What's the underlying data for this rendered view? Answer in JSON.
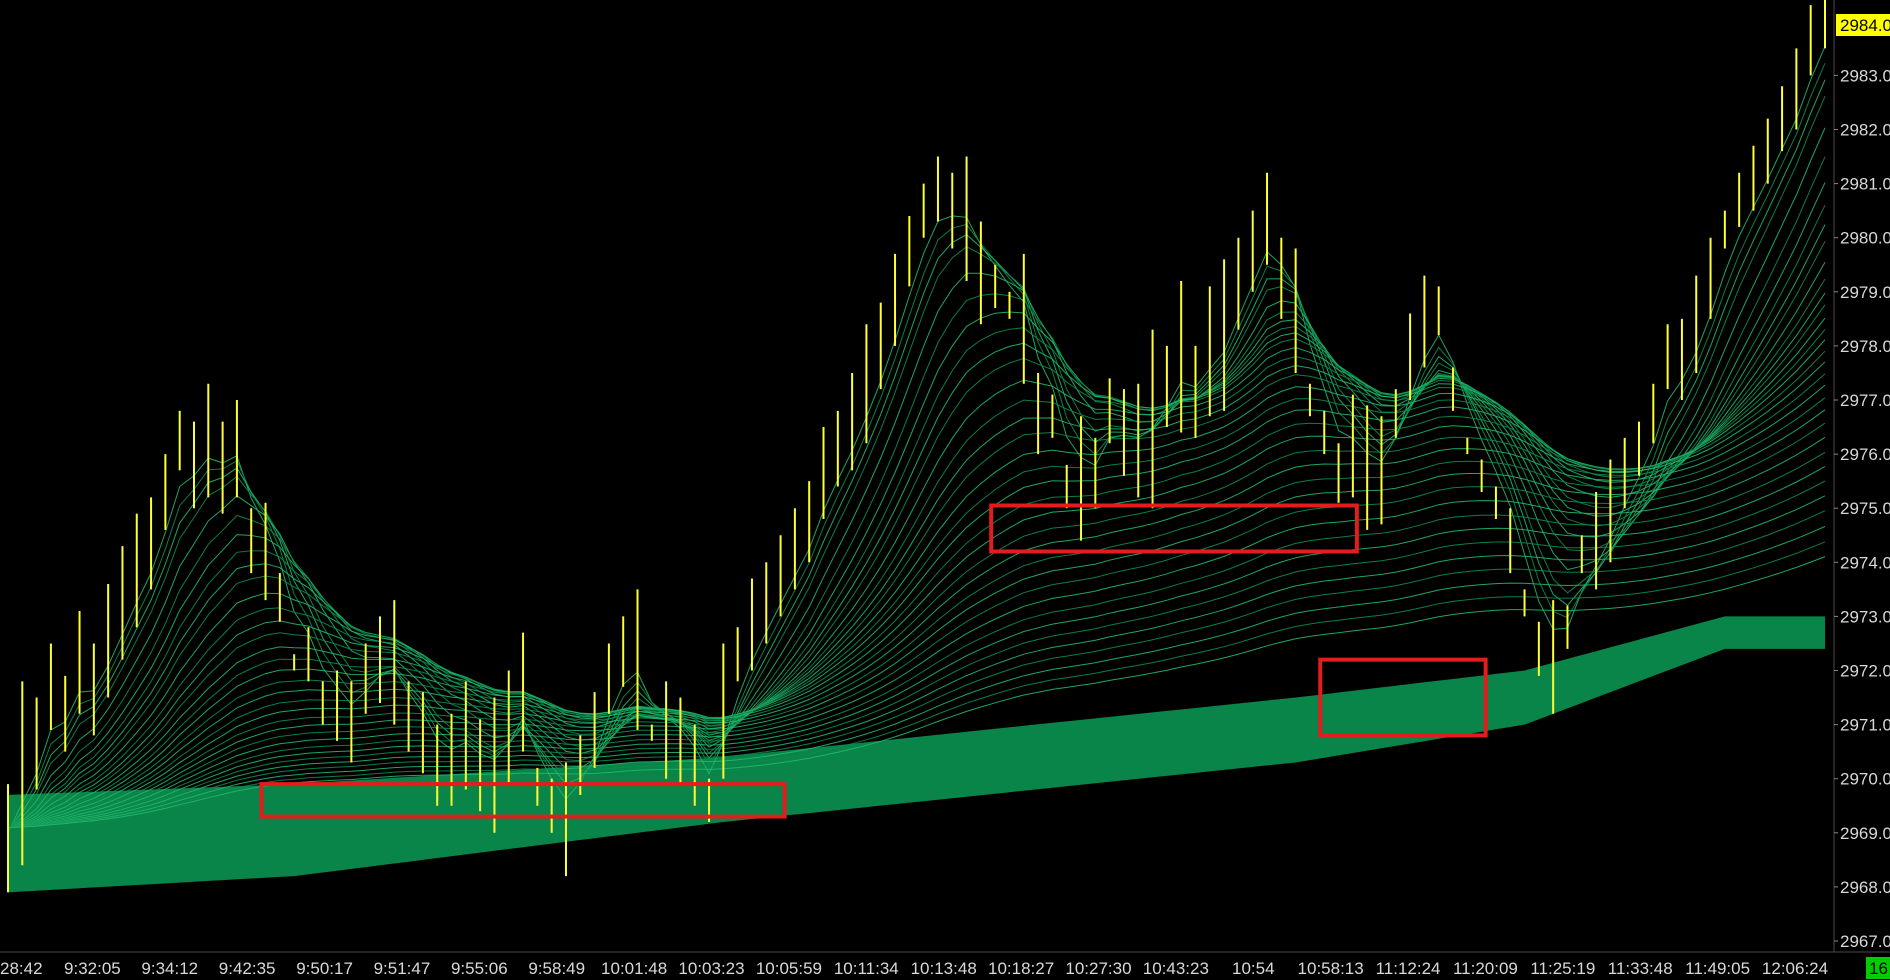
{
  "chart_data": {
    "type": "line",
    "colors": {
      "background": "#000000",
      "bar": "#ffff33",
      "ribbon": "#0b8c4e",
      "ribbon_line": "#21b86a",
      "highlight_box": "#e31c1c",
      "price_tag": "#ffff00",
      "time_tag": "#00cc00",
      "axis_text": "#d8d8d8"
    },
    "ylim": [
      2966.8,
      2984.6
    ],
    "y_ticks": [
      "2967.0",
      "2968.0",
      "2969.0",
      "2970.0",
      "2971.0",
      "2972.0",
      "2973.0",
      "2974.0",
      "2975.0",
      "2976.0",
      "2977.0",
      "2978.0",
      "2979.0",
      "2980.0",
      "2981.0",
      "2982.0",
      "2983.0",
      "2984.0"
    ],
    "x_ticks": [
      "28:42",
      "9:32:05",
      "9:34:12",
      "9:42:35",
      "9:50:17",
      "9:51:47",
      "9:55:06",
      "9:58:49",
      "10:01:48",
      "10:03:23",
      "10:05:59",
      "10:11:34",
      "10:13:48",
      "10:18:27",
      "10:27:30",
      "10:43:23",
      "10:54",
      "10:58:13",
      "11:12:24",
      "11:20:09",
      "11:25:19",
      "11:33:48",
      "11:49:05",
      "12:06:24"
    ],
    "last_price_label": "2984.0",
    "last_time_label": "16",
    "bar_count": 106,
    "bars": [
      [
        2967.9,
        2969.9
      ],
      [
        2968.4,
        2971.8
      ],
      [
        2969.8,
        2971.5
      ],
      [
        2970.9,
        2972.5
      ],
      [
        2970.5,
        2971.9
      ],
      [
        2971.2,
        2973.1
      ],
      [
        2970.8,
        2972.5
      ],
      [
        2971.5,
        2973.6
      ],
      [
        2972.2,
        2974.3
      ],
      [
        2972.8,
        2974.9
      ],
      [
        2973.5,
        2975.2
      ],
      [
        2974.6,
        2976.0
      ],
      [
        2975.7,
        2976.8
      ],
      [
        2975.0,
        2976.6
      ],
      [
        2975.2,
        2977.3
      ],
      [
        2974.9,
        2976.6
      ],
      [
        2975.2,
        2977.0
      ],
      [
        2973.8,
        2975.0
      ],
      [
        2973.3,
        2975.1
      ],
      [
        2972.9,
        2973.8
      ],
      [
        2972.0,
        2972.3
      ],
      [
        2971.8,
        2972.8
      ],
      [
        2971.0,
        2971.8
      ],
      [
        2970.7,
        2972.0
      ],
      [
        2970.3,
        2971.8
      ],
      [
        2971.2,
        2972.5
      ],
      [
        2971.4,
        2973.0
      ],
      [
        2971.0,
        2973.3
      ],
      [
        2970.5,
        2971.8
      ],
      [
        2970.1,
        2971.6
      ],
      [
        2969.5,
        2971.0
      ],
      [
        2969.5,
        2971.2
      ],
      [
        2969.8,
        2971.8
      ],
      [
        2969.4,
        2971.1
      ],
      [
        2969.0,
        2971.5
      ],
      [
        2969.9,
        2972.0
      ],
      [
        2970.5,
        2972.7
      ],
      [
        2969.5,
        2970.2
      ],
      [
        2969.0,
        2970.0
      ],
      [
        2968.2,
        2970.3
      ],
      [
        2969.7,
        2970.8
      ],
      [
        2970.2,
        2971.6
      ],
      [
        2971.2,
        2972.5
      ],
      [
        2971.7,
        2973.0
      ],
      [
        2970.9,
        2973.5
      ],
      [
        2970.7,
        2971.0
      ],
      [
        2970.0,
        2971.8
      ],
      [
        2969.9,
        2971.5
      ],
      [
        2969.5,
        2971.0
      ],
      [
        2969.2,
        2970.0
      ],
      [
        2970.0,
        2972.5
      ],
      [
        2971.8,
        2972.8
      ],
      [
        2972.0,
        2973.7
      ],
      [
        2972.5,
        2974.0
      ],
      [
        2973.0,
        2974.5
      ],
      [
        2973.5,
        2975.0
      ],
      [
        2974.0,
        2975.5
      ],
      [
        2974.8,
        2976.5
      ],
      [
        2975.4,
        2976.8
      ],
      [
        2975.7,
        2977.5
      ],
      [
        2976.2,
        2978.4
      ],
      [
        2977.2,
        2978.8
      ],
      [
        2978.0,
        2979.7
      ],
      [
        2979.1,
        2980.4
      ],
      [
        2980.0,
        2981.0
      ],
      [
        2980.3,
        2981.5
      ],
      [
        2979.8,
        2981.2
      ],
      [
        2979.2,
        2981.5
      ],
      [
        2978.4,
        2980.3
      ],
      [
        2978.7,
        2979.5
      ],
      [
        2978.5,
        2979.0
      ],
      [
        2977.3,
        2979.7
      ],
      [
        2976.0,
        2977.5
      ],
      [
        2976.3,
        2977.1
      ],
      [
        2975.0,
        2975.8
      ],
      [
        2974.4,
        2976.7
      ],
      [
        2975.0,
        2976.3
      ],
      [
        2976.2,
        2977.4
      ],
      [
        2975.6,
        2977.2
      ],
      [
        2975.2,
        2977.3
      ],
      [
        2975.0,
        2978.3
      ],
      [
        2976.5,
        2978.0
      ],
      [
        2976.4,
        2979.2
      ],
      [
        2976.3,
        2978.0
      ],
      [
        2976.7,
        2979.1
      ],
      [
        2976.8,
        2979.6
      ],
      [
        2978.3,
        2980.0
      ],
      [
        2979.0,
        2980.5
      ],
      [
        2979.5,
        2981.2
      ],
      [
        2978.5,
        2980.0
      ],
      [
        2977.5,
        2979.8
      ],
      [
        2976.7,
        2977.3
      ],
      [
        2976.0,
        2976.8
      ],
      [
        2975.1,
        2976.2
      ],
      [
        2975.2,
        2977.1
      ],
      [
        2974.6,
        2976.9
      ],
      [
        2974.7,
        2976.7
      ],
      [
        2976.3,
        2977.2
      ],
      [
        2977.0,
        2978.6
      ],
      [
        2977.6,
        2979.3
      ],
      [
        2978.2,
        2979.1
      ],
      [
        2976.8,
        2977.6
      ],
      [
        2976.0,
        2976.3
      ],
      [
        2975.3,
        2975.9
      ],
      [
        2974.8,
        2975.4
      ],
      [
        2973.8,
        2975.0
      ],
      [
        2973.0,
        2973.5
      ],
      [
        2971.9,
        2972.9
      ],
      [
        2971.2,
        2973.3
      ],
      [
        2972.4,
        2973.2
      ],
      [
        2973.8,
        2974.5
      ],
      [
        2973.5,
        2975.3
      ],
      [
        2974.0,
        2975.9
      ],
      [
        2975.0,
        2976.3
      ],
      [
        2975.6,
        2976.6
      ],
      [
        2976.2,
        2977.3
      ],
      [
        2977.2,
        2978.4
      ],
      [
        2977.0,
        2978.5
      ],
      [
        2977.5,
        2979.3
      ],
      [
        2978.5,
        2980.0
      ],
      [
        2979.8,
        2980.5
      ],
      [
        2980.2,
        2981.2
      ],
      [
        2980.5,
        2981.7
      ],
      [
        2981.0,
        2982.2
      ],
      [
        2981.6,
        2982.8
      ],
      [
        2982.0,
        2983.5
      ],
      [
        2983.0,
        2984.3
      ],
      [
        2983.5,
        2984.8
      ]
    ],
    "ma_band": {
      "outer_low": [
        [
          0,
          2967.9
        ],
        [
          20,
          2968.2
        ],
        [
          50,
          2969.2
        ],
        [
          90,
          2970.3
        ],
        [
          106,
          2971.0
        ],
        [
          120,
          2972.4
        ]
      ],
      "outer_high": [
        [
          0,
          2969.7
        ],
        [
          20,
          2969.9
        ],
        [
          50,
          2970.4
        ],
        [
          90,
          2971.5
        ],
        [
          106,
          2972.0
        ],
        [
          120,
          2973.0
        ]
      ]
    },
    "highlight_boxes": [
      {
        "x_start": 2969.9,
        "x_end": 2969.3,
        "label": ""
      },
      {
        "x_start": 2975.05,
        "x_end": 2974.2,
        "label": ""
      },
      {
        "x_start": 2972.2,
        "x_end": 2970.8,
        "label": ""
      }
    ]
  }
}
